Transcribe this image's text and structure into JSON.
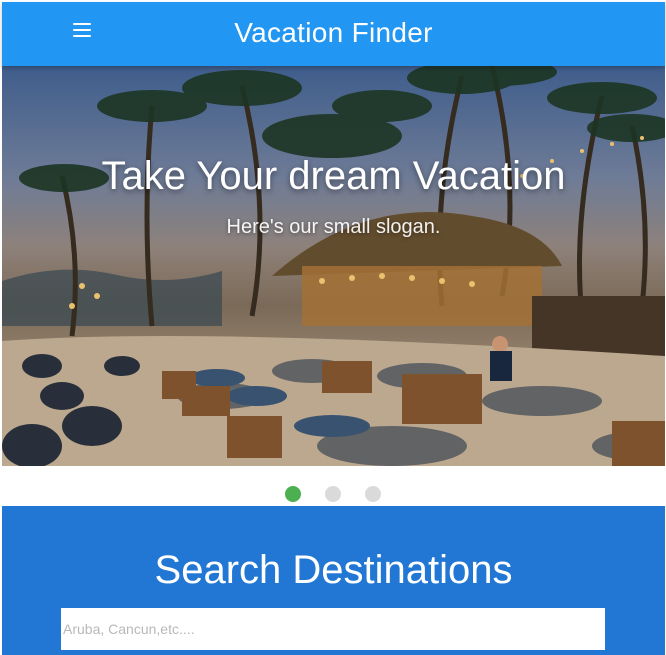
{
  "header": {
    "title": "Vacation Finder",
    "menu_icon": "hamburger-menu-icon",
    "background": "#2196f3"
  },
  "carousel": {
    "slide_title": "Take Your dream Vacation",
    "slide_subtitle": "Here's our small slogan.",
    "slide_count": 3,
    "active_slide_index": 0,
    "active_color": "#4caf50",
    "inactive_color": "#dadada"
  },
  "search": {
    "title": "Search Destinations",
    "placeholder": "Aruba, Cancun,etc....",
    "value": "",
    "background": "#2177d3"
  }
}
